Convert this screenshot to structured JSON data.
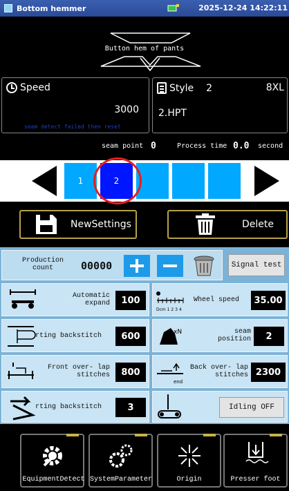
{
  "statusbar": {
    "title": "Bottom hemmer",
    "datetime": "2025-12-24 14:22:11"
  },
  "header": {
    "label": "Button hem of pants"
  },
  "speed": {
    "title": "Speed",
    "value": "3000",
    "message": "seam detect failed then reset"
  },
  "style": {
    "title": "Style",
    "number": "2",
    "size": "8XL",
    "name": "2.HPT"
  },
  "seam": {
    "point_label": "seam point",
    "point_value": "0",
    "time_label": "Process time",
    "time_value": "0.0",
    "time_unit": "second"
  },
  "steps": {
    "items": [
      "1",
      "2",
      "",
      "",
      "",
      ""
    ],
    "selected_index": 1
  },
  "actions": {
    "newsettings": "NewSettings",
    "delete": "Delete"
  },
  "production": {
    "label": "Production count",
    "value": "00000",
    "signal_test": "Signal test"
  },
  "params": {
    "automatic_expand": {
      "label": "Automatic expand",
      "value": "100"
    },
    "wheel_speed": {
      "label": "Wheel speed",
      "value": "35.00"
    },
    "starting_backstitch_1": {
      "label": "rting backstitch",
      "value": "600"
    },
    "seam_position": {
      "label": "seam position",
      "value": "2"
    },
    "front_overlap": {
      "label": "Front over- lap stitches",
      "value": "800"
    },
    "back_overlap": {
      "label": "Back over- lap stitches",
      "value": "2300"
    },
    "starting_backstitch_2": {
      "label": "rting backstitch",
      "value": "3"
    },
    "idling": {
      "label": "Idling OFF"
    }
  },
  "icons": {
    "wheel_ruler": "Dcm 1 2 3 4",
    "seam_xN": "xN",
    "back_end": "end"
  },
  "nav": {
    "equipment": "EquipmentDetect",
    "system": "SystemParameter",
    "origin": "Origin",
    "presser": "Presser foot"
  },
  "colors": {
    "step_blue": "#00a8ff",
    "step_selected": "#0016ff",
    "ring": "#e81e1e",
    "panel_bg": "#c9e4f4",
    "accent_gold": "#b8a14a"
  }
}
